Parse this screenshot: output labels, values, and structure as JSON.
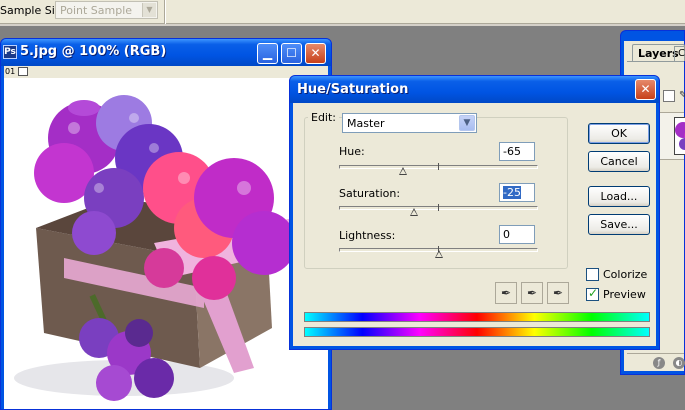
{
  "options_bar": {
    "sample_size_label": "Sample Size:",
    "sample_size_value": "Point Sample"
  },
  "document": {
    "title": "5.jpg @ 100% (RGB)",
    "status_text": "01"
  },
  "layers_panel": {
    "tab_label": "Layers",
    "tab2_label": "Char"
  },
  "dialog": {
    "title": "Hue/Saturation",
    "edit_label": "Edit:",
    "edit_value": "Master",
    "sliders": [
      {
        "label": "Hue:",
        "value": "-65",
        "level": 0.32
      },
      {
        "label": "Saturation:",
        "value": "-25",
        "level": 0.375
      },
      {
        "label": "Lightness:",
        "value": "0",
        "level": 0.5
      }
    ],
    "buttons": {
      "ok": "OK",
      "cancel": "Cancel",
      "load": "Load...",
      "save": "Save..."
    },
    "checkboxes": {
      "colorize_label": "Colorize",
      "colorize_checked": false,
      "preview_label": "Preview",
      "preview_checked": true
    }
  },
  "colors": {
    "xp_blue": "#0054e3",
    "dialog_bg": "#ece9d8",
    "flower_magenta": "#c02cc8",
    "flower_purple": "#7a3fc0",
    "flower_pink": "#ff4f8a",
    "box_brown": "#6e5a4e"
  }
}
